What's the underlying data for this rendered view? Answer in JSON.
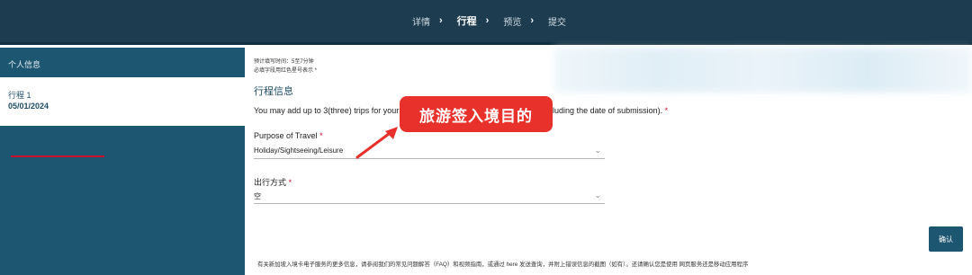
{
  "nav": {
    "steps": [
      {
        "label": "详情",
        "active": false
      },
      {
        "label": "行程",
        "active": true
      },
      {
        "label": "预览",
        "active": false
      },
      {
        "label": "提交",
        "active": false
      }
    ],
    "separator": "›"
  },
  "sidebar": {
    "personal_info": "个人信息",
    "trip": {
      "title": "行程 1",
      "date": "05/01/2024"
    }
  },
  "form": {
    "meta_time": "预计填写时间：5至7分钟",
    "meta_required": "必填字段用红色星号表示 *",
    "section_title": "行程信息",
    "instruction_start": "You may add up to 3(three) trips for your",
    "instruction_end": "r trip must be within 3 days (including the date of submission).",
    "required_mark": "*",
    "purpose_label": "Purpose of Travel",
    "purpose_value": "Holiday/Sightseeing/Leisure",
    "travel_mode_label": "出行方式",
    "travel_mode_value": "空",
    "confirm_button": "确认",
    "footer_text": "有关新加坡入境卡电子服务的更多信息，请参阅我们的常见问题解答（FAQ）和视频指南，或通过 here 发送查询，并附上错误信息的截图（如有）。还请确认您是使用 网页服务还是移动应用程序"
  },
  "annotation": {
    "callout_text": "旅游签入境目的",
    "color": "#e8312a"
  },
  "colors": {
    "topbar": "#1d3c4f",
    "sidebar": "#1d5670",
    "required": "#c8102e"
  }
}
